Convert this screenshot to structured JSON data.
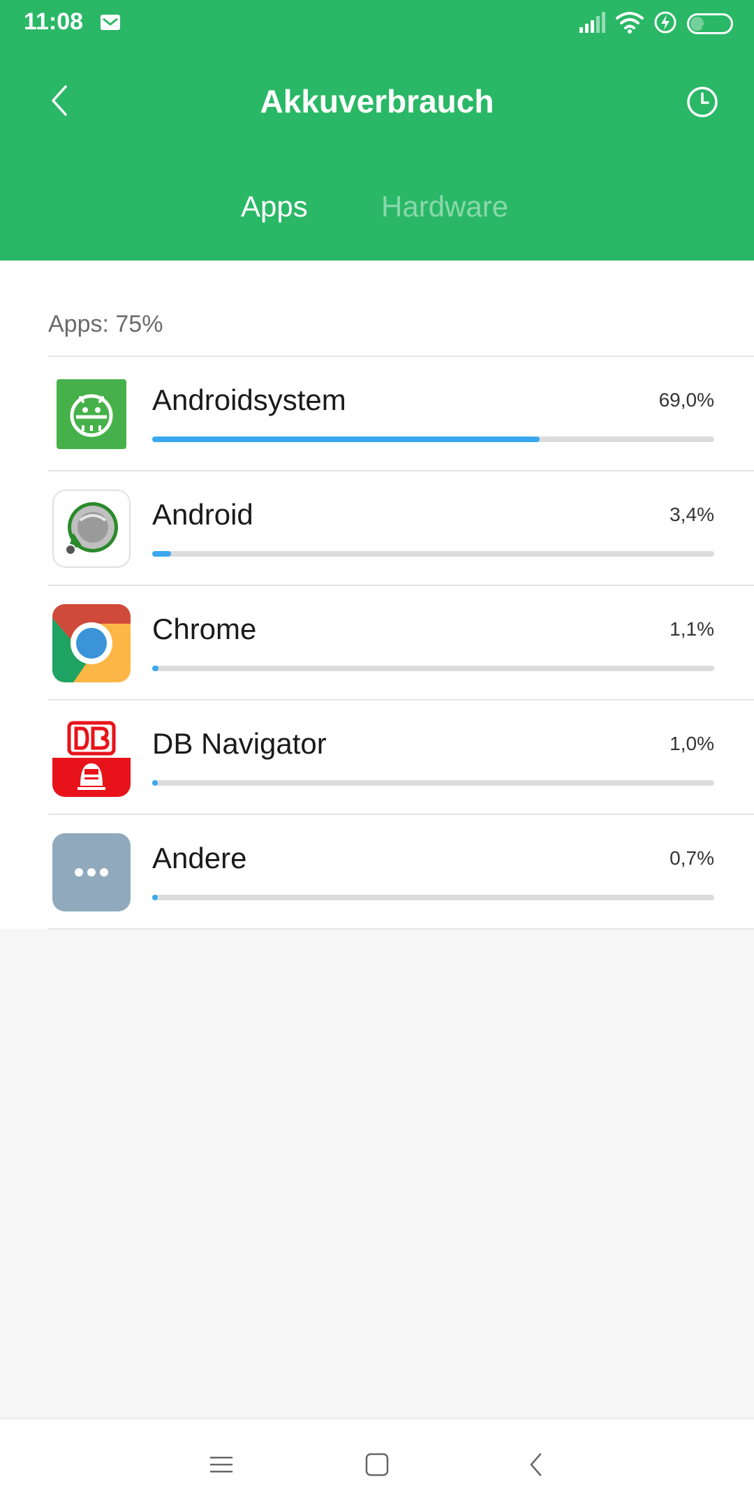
{
  "status_bar": {
    "time": "11:08",
    "battery_level": "39",
    "icons": [
      "mail-icon",
      "signal-icon",
      "wifi-icon",
      "charging-icon",
      "battery-icon"
    ]
  },
  "header": {
    "title": "Akkuverbrauch",
    "back_icon": "back-chevron-icon",
    "history_icon": "clock-icon",
    "accent_color": "#2ab866"
  },
  "tabs": [
    {
      "label": "Apps",
      "active": true
    },
    {
      "label": "Hardware",
      "active": false
    }
  ],
  "summary": {
    "label": "Apps: 75%"
  },
  "apps": [
    {
      "name": "Androidsystem",
      "percent_label": "69,0%",
      "percent": 69.0,
      "icon": "android-system-icon"
    },
    {
      "name": "Android",
      "percent_label": "3,4%",
      "percent": 3.4,
      "icon": "android-sound-icon"
    },
    {
      "name": "Chrome",
      "percent_label": "1,1%",
      "percent": 1.1,
      "icon": "chrome-icon"
    },
    {
      "name": "DB Navigator",
      "percent_label": "1,0%",
      "percent": 1.0,
      "icon": "db-navigator-icon"
    },
    {
      "name": "Andere",
      "percent_label": "0,7%",
      "percent": 0.7,
      "icon": "more-dots-icon"
    }
  ],
  "bar_color": "#3aa8ee",
  "nav_bar": {
    "icons": [
      "menu-icon",
      "home-square-icon",
      "back-icon"
    ]
  }
}
